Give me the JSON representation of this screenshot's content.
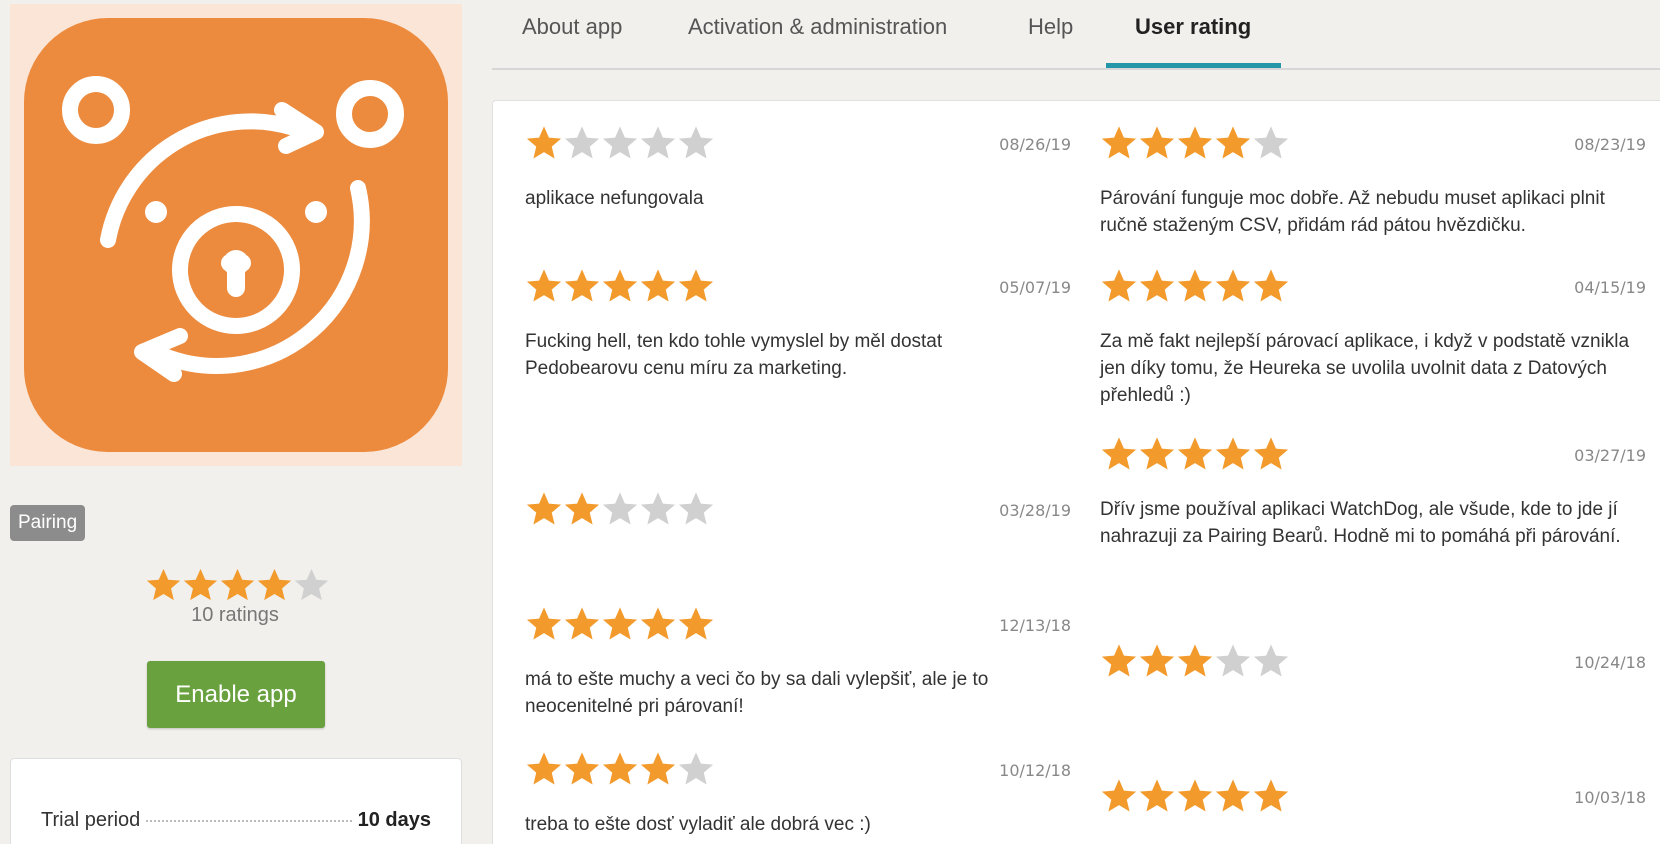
{
  "tabs": [
    {
      "label": "About app"
    },
    {
      "label": "Activation & administration"
    },
    {
      "label": "Help"
    },
    {
      "label": "User rating",
      "active": true
    }
  ],
  "app": {
    "icon": "orange-bear-pairing-icon",
    "category": "Pairing",
    "average_rating": 4,
    "rating_count_label": "10 ratings",
    "enable_label": "Enable app",
    "trial_period_label": "Trial period",
    "trial_period_value": "10 days"
  },
  "colors": {
    "star_filled": "#f39a2c",
    "star_empty": "#d0d0d0",
    "enable_button": "#6aa13f",
    "tab_underline": "#2396a8",
    "icon_background": "#ec8a3d"
  },
  "reviews": [
    {
      "rating": 1,
      "date": "08/26/19",
      "text": "aplikace nefungovala"
    },
    {
      "rating": 4,
      "date": "08/23/19",
      "text": "Párování funguje moc dobře. Až nebudu muset aplikaci plnit ručně staženým CSV, přidám rád pátou hvězdičku."
    },
    {
      "rating": 5,
      "date": "05/07/19",
      "text": "Fucking hell, ten kdo tohle vymyslel by měl dostat Pedobearovu cenu míru za marketing."
    },
    {
      "rating": 5,
      "date": "04/15/19",
      "text": "Za mě fakt nejlepší párovací aplikace, i když v podstatě vznikla jen díky tomu, že Heureka se uvolila uvolnit data z Datových přehledů :)"
    },
    {
      "rating": 5,
      "date": "03/27/19",
      "text": "Dřív jsme používal aplikaci WatchDog, ale všude, kde to jde jí nahrazuji za Pairing Bearů. Hodně mi to pomáhá při párování."
    },
    {
      "rating": 2,
      "date": "03/28/19",
      "text": ""
    },
    {
      "rating": 5,
      "date": "12/13/18",
      "text": "má to ešte muchy a veci čo by sa dali vylepšiť, ale je to neocenitelné pri párovaní!"
    },
    {
      "rating": 3,
      "date": "10/24/18",
      "text": ""
    },
    {
      "rating": 4,
      "date": "10/12/18",
      "text": "treba to ešte dosť vyladiť ale dobrá vec :)"
    },
    {
      "rating": 5,
      "date": "10/03/18",
      "text": ""
    }
  ]
}
